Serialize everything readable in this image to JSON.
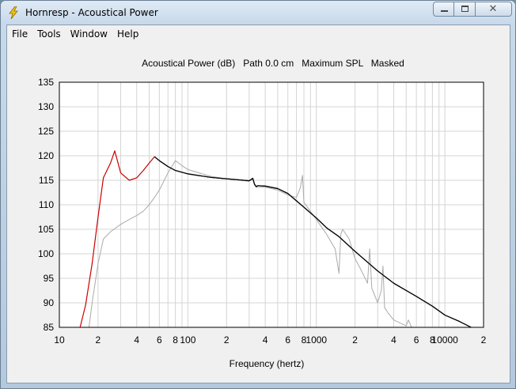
{
  "window": {
    "title": "Hornresp - Acoustical Power",
    "close_glyph": "✕"
  },
  "menu": {
    "items": [
      "File",
      "Tools",
      "Window",
      "Help"
    ]
  },
  "colors": {
    "primary_line": "#000000",
    "low_freq_line": "#cc0000",
    "secondary_line": "#aaaaaa",
    "grid": "#d4d4d4"
  },
  "chart_data": {
    "type": "line",
    "title": "Acoustical Power (dB)   Path 0.0 cm   Maximum SPL   Masked",
    "xlabel": "Frequency (hertz)",
    "ylabel": "",
    "x_scale": "log",
    "xlim": [
      10,
      20000
    ],
    "ylim": [
      85,
      135
    ],
    "x_tick_labels": [
      {
        "value": 10,
        "label": "10"
      },
      {
        "value": 20,
        "label": "2"
      },
      {
        "value": 40,
        "label": "4"
      },
      {
        "value": 60,
        "label": "6"
      },
      {
        "value": 80,
        "label": "8"
      },
      {
        "value": 100,
        "label": "100"
      },
      {
        "value": 200,
        "label": "2"
      },
      {
        "value": 400,
        "label": "4"
      },
      {
        "value": 600,
        "label": "6"
      },
      {
        "value": 800,
        "label": "8"
      },
      {
        "value": 1000,
        "label": "1000"
      },
      {
        "value": 2000,
        "label": "2"
      },
      {
        "value": 4000,
        "label": "4"
      },
      {
        "value": 6000,
        "label": "6"
      },
      {
        "value": 8000,
        "label": "8"
      },
      {
        "value": 10000,
        "label": "10000"
      },
      {
        "value": 20000,
        "label": "2"
      }
    ],
    "y_ticks": [
      85,
      90,
      95,
      100,
      105,
      110,
      115,
      120,
      125,
      130,
      135
    ],
    "grid": true,
    "series": [
      {
        "color": "#cc0000",
        "x": [
          14.5,
          16,
          18,
          20,
          22,
          25,
          27,
          30,
          35,
          40,
          45,
          50,
          55
        ],
        "y": [
          85,
          89.5,
          98,
          107.5,
          115.5,
          118.5,
          121,
          116.5,
          115,
          115.5,
          117,
          118.5,
          119.8
        ]
      },
      {
        "color": "#000000",
        "x": [
          55,
          60,
          70,
          80,
          100,
          150,
          200,
          300,
          320,
          330,
          340,
          350,
          400,
          500,
          600,
          700,
          800,
          1000,
          1200,
          1500,
          2000,
          3000,
          4000,
          6000,
          8000,
          10000,
          13000,
          16000
        ],
        "y": [
          119.8,
          119,
          117.8,
          117,
          116.3,
          115.6,
          115.3,
          114.9,
          115.4,
          114.2,
          113.7,
          113.9,
          113.8,
          113.3,
          112.3,
          110.8,
          109.5,
          107.3,
          105.3,
          103.5,
          100.5,
          96.5,
          94,
          91.3,
          89.3,
          87.5,
          86.2,
          85
        ]
      },
      {
        "color": "#aaaaaa",
        "x": [
          17,
          18,
          20,
          22,
          25,
          30,
          35,
          40,
          45,
          50,
          55,
          60,
          70,
          80,
          90,
          100,
          150,
          200,
          300,
          320,
          330,
          340,
          400,
          500,
          600,
          700,
          750,
          780,
          800,
          1000,
          1200,
          1400,
          1500,
          1550,
          1600,
          1800,
          2000,
          2200,
          2500,
          2600,
          2700,
          3000,
          3200,
          3300,
          3400,
          3600,
          4000,
          5000,
          5200,
          5500
        ],
        "y": [
          85,
          90,
          98,
          103,
          104.5,
          106,
          107,
          107.8,
          108.7,
          110,
          111.5,
          113,
          116.5,
          119,
          118,
          117.2,
          115.8,
          115.3,
          114.8,
          115.1,
          114,
          113.6,
          113.6,
          113,
          112,
          111.5,
          113.5,
          116,
          110.5,
          107,
          104,
          101,
          96,
          104,
          105,
          103,
          99,
          97,
          94,
          101,
          93,
          90,
          92.5,
          97.5,
          89,
          88,
          86.5,
          85.3,
          86.5,
          85
        ]
      }
    ]
  }
}
